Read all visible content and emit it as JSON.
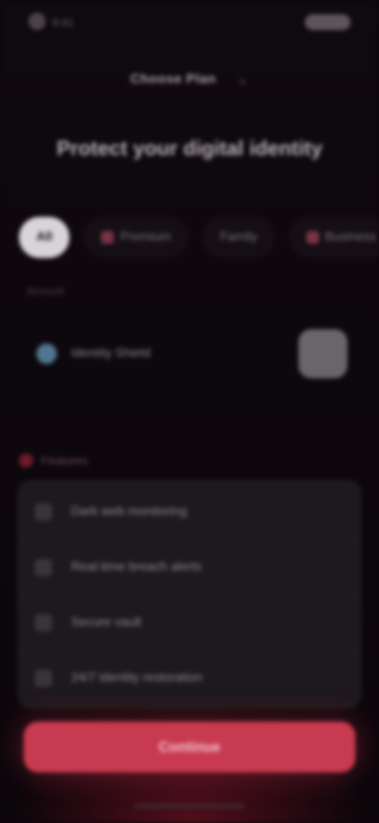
{
  "status_bar": {
    "time": "9:41",
    "left_icon": "app-avatar-icon",
    "right_icon": "battery-icon"
  },
  "header": {
    "title": "Choose Plan",
    "chevron_icon": "chevron-down-icon"
  },
  "headline": "Protect your digital identity",
  "chips": [
    {
      "label": "All",
      "active": true
    },
    {
      "label": "Premium",
      "icon": "crown-icon"
    },
    {
      "label": "Family"
    },
    {
      "label": "Business",
      "icon": "briefcase-icon"
    }
  ],
  "account_section": {
    "caption": "Account",
    "row_label": "Identity Shield",
    "row_icon": "shield-icon",
    "toggle_icon": "toggle-icon"
  },
  "features_section": {
    "title": "Features",
    "icon": "alert-icon",
    "items": [
      {
        "label": "Dark web monitoring",
        "icon": "eye-icon"
      },
      {
        "label": "Real-time breach alerts",
        "icon": "bell-icon"
      },
      {
        "label": "Secure vault",
        "icon": "lock-icon"
      },
      {
        "label": "24/7 identity restoration",
        "icon": "support-icon"
      }
    ]
  },
  "cta": {
    "label": "Continue"
  },
  "colors": {
    "background": "#0d070c",
    "accent": "#c83a50",
    "card": "#1d191d"
  }
}
